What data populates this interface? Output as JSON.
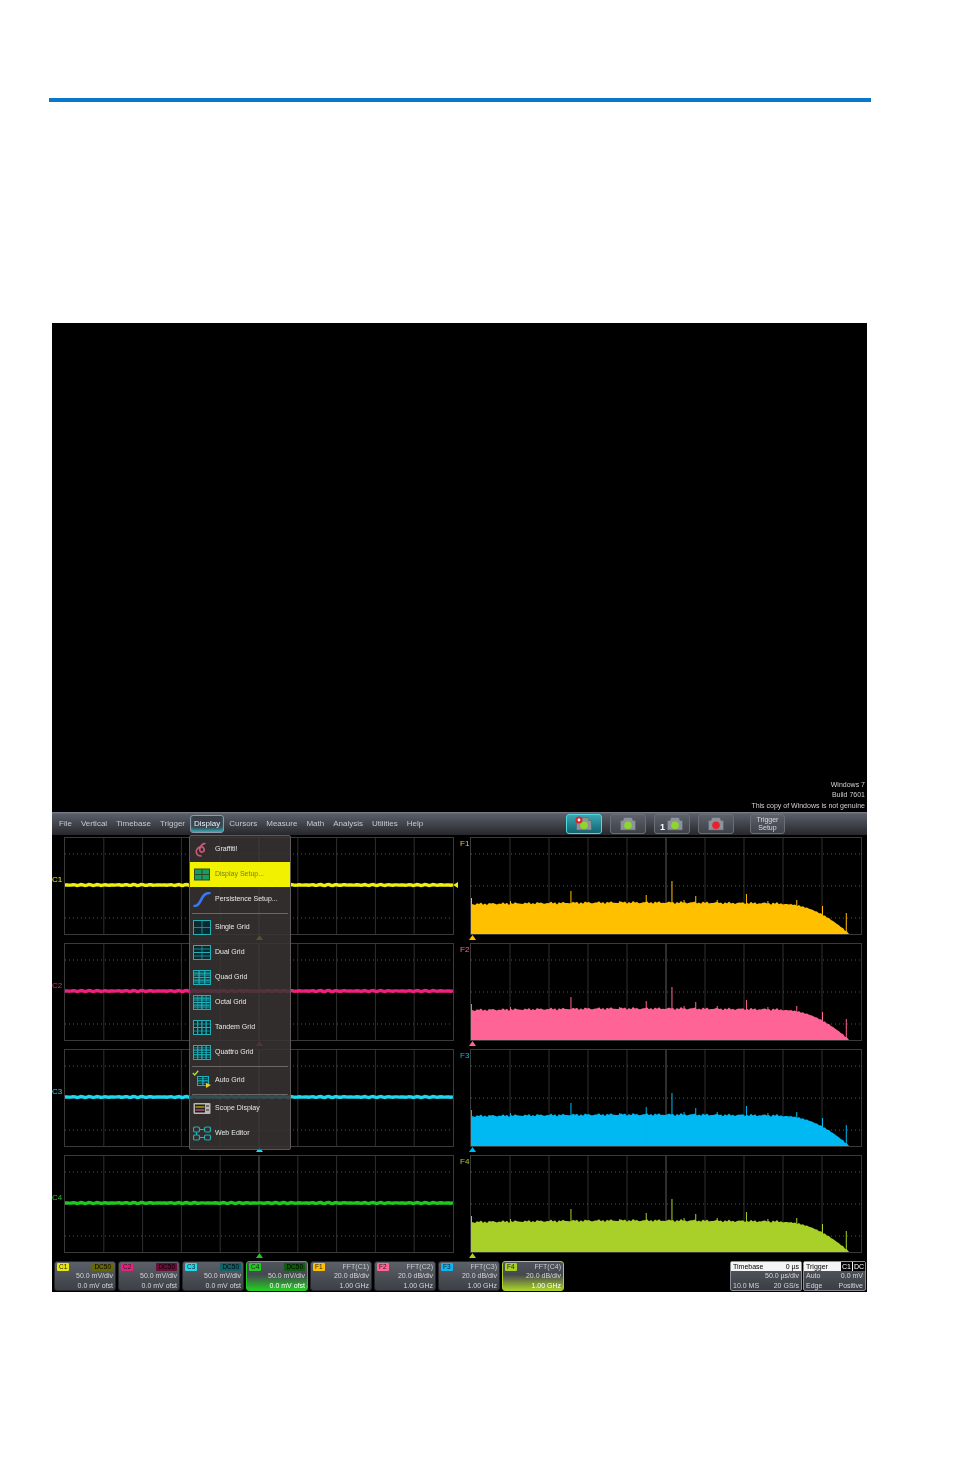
{
  "screen": {
    "os_notice": [
      "Windows 7",
      "Build 7601",
      "This copy of Windows is not genuine"
    ],
    "menu_bar": [
      {
        "label": "File",
        "selected": false
      },
      {
        "label": "Vertical",
        "selected": false
      },
      {
        "label": "Timebase",
        "selected": false
      },
      {
        "label": "Trigger",
        "selected": false
      },
      {
        "label": "Display",
        "selected": true
      },
      {
        "label": "Cursors",
        "selected": false
      },
      {
        "label": "Measure",
        "selected": false
      },
      {
        "label": "Math",
        "selected": false
      },
      {
        "label": "Analysis",
        "selected": false
      },
      {
        "label": "Utilities",
        "selected": false
      },
      {
        "label": "Help",
        "selected": false
      }
    ],
    "toolbar": [
      {
        "kind": "gear_lamp",
        "color": "#8fd62a",
        "selected": true
      },
      {
        "kind": "lamp",
        "color": "#8fd62a",
        "selected": false
      },
      {
        "kind": "numbered_lamp",
        "badge": "1",
        "color": "#8fd62a",
        "selected": false
      },
      {
        "kind": "lamp",
        "color": "#e8202c",
        "selected": false
      },
      {
        "kind": "text",
        "label": "Trigger Setup",
        "selected": false
      }
    ],
    "menu": {
      "groups": [
        [
          {
            "kind": "graffiti",
            "label": "Graffiti!",
            "selected": false,
            "checked": false
          },
          {
            "kind": "display_setup",
            "label": "Display Setup...",
            "selected": true,
            "checked": false
          },
          {
            "kind": "persistence",
            "label": "Persistence Setup...",
            "selected": false,
            "checked": false
          }
        ],
        [
          {
            "kind": "single_grid",
            "label": "Single Grid",
            "selected": false,
            "checked": false
          },
          {
            "kind": "dual_grid",
            "label": "Dual Grid",
            "selected": false,
            "checked": false
          },
          {
            "kind": "quad_grid",
            "label": "Quad Grid",
            "selected": false,
            "checked": false
          },
          {
            "kind": "octal_grid",
            "label": "Octal Grid",
            "selected": false,
            "checked": false
          },
          {
            "kind": "tandem_grid",
            "label": "Tandem Grid",
            "selected": false,
            "checked": false
          },
          {
            "kind": "quattro_grid",
            "label": "Quattro Grid",
            "selected": false,
            "checked": false
          }
        ],
        [
          {
            "kind": "auto_grid",
            "label": "Auto Grid",
            "selected": false,
            "checked": true
          }
        ],
        [
          {
            "kind": "scope_display",
            "label": "Scope Display",
            "selected": false,
            "checked": false
          },
          {
            "kind": "web_editor",
            "label": "Web Editor",
            "selected": false,
            "checked": false
          }
        ]
      ]
    },
    "channel_grids": [
      {
        "label": "C1",
        "color": "#eeee10",
        "trigger_marker": true
      },
      {
        "label": "C2",
        "color": "#f0207e",
        "trigger_marker": false
      },
      {
        "label": "C3",
        "color": "#1ed8f0",
        "trigger_marker": false
      },
      {
        "label": "C4",
        "color": "#1ec81e",
        "trigger_marker": false
      }
    ],
    "spectrum_grids": [
      {
        "label": "F1",
        "color": "#ffc000"
      },
      {
        "label": "F2",
        "color": "#ff6496"
      },
      {
        "label": "F3",
        "color": "#00b8f2"
      },
      {
        "label": "F4",
        "color": "#a8d028"
      }
    ],
    "descriptors": [
      {
        "kind": "channel",
        "label": "C1",
        "coupling": "DC50",
        "scale": "50.0 mV/div",
        "offset": "0.0 mV ofst",
        "color": "#e8e810",
        "selected": false
      },
      {
        "kind": "channel",
        "label": "C2",
        "coupling": "DC50",
        "scale": "50.0 mV/div",
        "offset": "0.0 mV ofst",
        "color": "#e8207c",
        "selected": false
      },
      {
        "kind": "channel",
        "label": "C3",
        "coupling": "DC50",
        "scale": "50.0 mV/div",
        "offset": "0.0 mV ofst",
        "color": "#22dcee",
        "selected": false
      },
      {
        "kind": "channel",
        "label": "C4",
        "coupling": "DC50",
        "scale": "50.0 mV/div",
        "offset": "0.0 mV ofst",
        "color": "#22cc22",
        "selected": true
      },
      {
        "kind": "math",
        "label": "F1",
        "source": "FFT(C1)",
        "scale": "20.0 dB/div",
        "frequency": "1.00 GHz",
        "color": "#ffc000",
        "selected": false
      },
      {
        "kind": "math",
        "label": "F2",
        "source": "FFT(C2)",
        "scale": "20.0 dB/div",
        "frequency": "1.00 GHz",
        "color": "#ff6496",
        "selected": false
      },
      {
        "kind": "math",
        "label": "F3",
        "source": "FFT(C3)",
        "scale": "20.0 dB/div",
        "frequency": "1.00 GHz",
        "color": "#10b4f0",
        "selected": false
      },
      {
        "kind": "math",
        "label": "F4",
        "source": "FFT(C4)",
        "scale": "20.0 dB/div",
        "frequency": "1.00 GHz",
        "color": "#a8d028",
        "selected": true
      }
    ],
    "timebase": {
      "title": "Timebase",
      "delay": "0 µs",
      "scale": "50.0 µs/div",
      "samples": "10.0 MS",
      "rate": "20 GS/s"
    },
    "trigger": {
      "title": "Trigger",
      "source": "C1",
      "coupling": "DC",
      "mode": "Auto",
      "threshold": "0.0 mV",
      "type": "Edge",
      "slope": "Positive"
    }
  }
}
